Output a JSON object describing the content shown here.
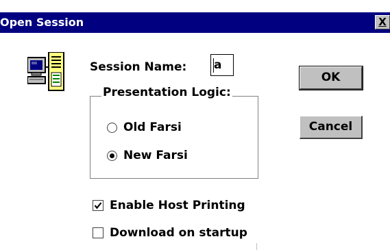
{
  "window": {
    "title": "Open Session",
    "close_glyph": "X",
    "title_bar_color": "#000080"
  },
  "icon": {
    "name": "session-computer-icon"
  },
  "session": {
    "label": "Session Name:",
    "value": "a"
  },
  "presentation": {
    "legend": "Presentation Logic:",
    "options": [
      {
        "label": "Old Farsi",
        "selected": false
      },
      {
        "label": "New Farsi",
        "selected": true
      }
    ]
  },
  "checkboxes": [
    {
      "label": "Enable Host Printing",
      "checked": true
    },
    {
      "label": "Download on startup",
      "checked": false
    }
  ],
  "buttons": {
    "ok_label": "OK",
    "cancel_label": "Cancel"
  }
}
